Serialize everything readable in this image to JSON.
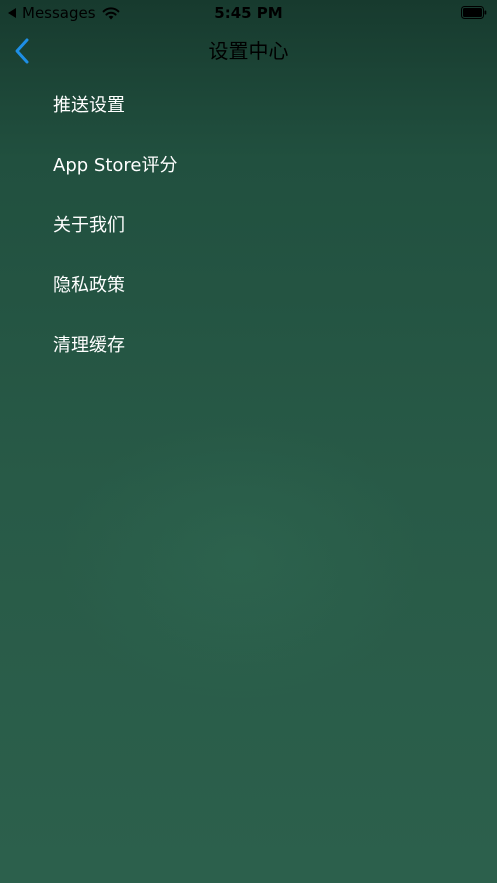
{
  "status_bar": {
    "back_app": "Messages",
    "time": "5:45 PM",
    "icons": [
      "back-triangle-icon",
      "wifi-icon",
      "battery-icon"
    ]
  },
  "nav": {
    "title": "设置中心",
    "back_icon": "chevron-left-icon"
  },
  "menu": {
    "items": [
      {
        "label": "推送设置"
      },
      {
        "label": "App Store评分"
      },
      {
        "label": "关于我们"
      },
      {
        "label": "隐私政策"
      },
      {
        "label": "清理缓存"
      }
    ]
  },
  "colors": {
    "background_top": "#173a2e",
    "background_bottom": "#2c604c",
    "accent": "#1e8fe6",
    "text": "#ffffff",
    "title_text": "#000000"
  }
}
